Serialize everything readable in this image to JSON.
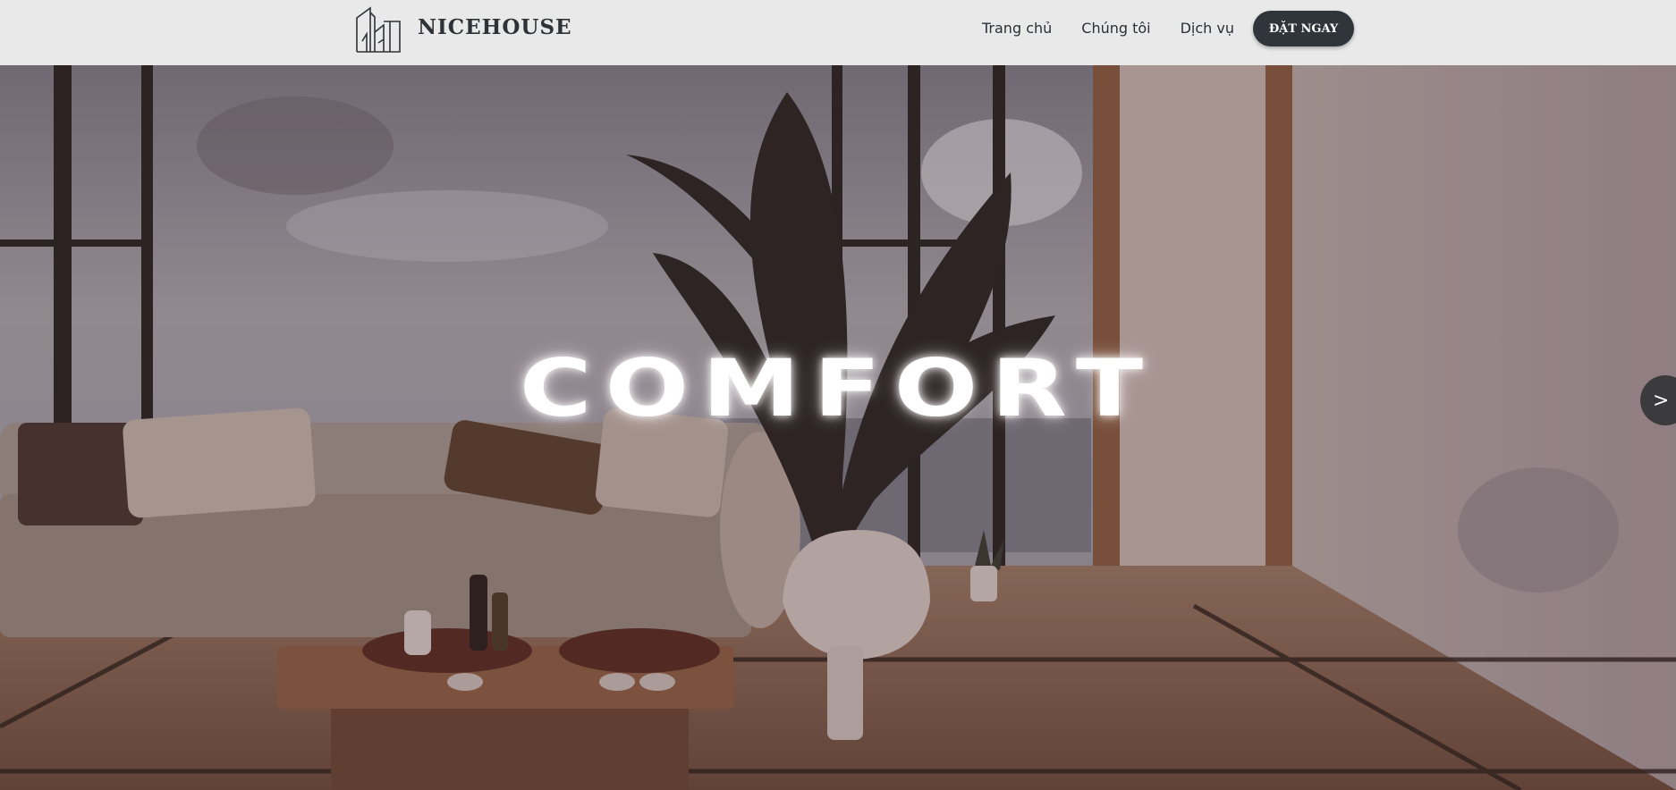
{
  "header": {
    "brand": "NICEHOUSE",
    "logo_icon": "building-outline-icon",
    "nav": [
      {
        "label": "Trang chủ"
      },
      {
        "label": "Chúng tôi"
      },
      {
        "label": "Dịch vụ"
      }
    ],
    "cta_label": "ĐẶT NGAY"
  },
  "hero": {
    "title": "COMFORT",
    "next_label": ">",
    "next_icon": "chevron-right-icon"
  },
  "colors": {
    "header_bg": "#e9e9e9",
    "brand_text": "#2f3237",
    "cta_bg": "#2f353b",
    "next_button_bg": "#3b3a3c"
  }
}
